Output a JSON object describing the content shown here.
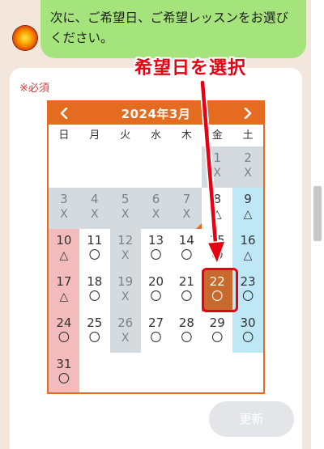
{
  "chat": {
    "message": "次に、ご希望日、ご希望レッスンをお選びください。"
  },
  "form": {
    "required_label": "※必須",
    "update_label": "更新"
  },
  "calendar": {
    "title": "2024年3月",
    "prev_icon": "chevron-left-icon",
    "next_icon": "chevron-right-icon",
    "weekdays": [
      "日",
      "月",
      "火",
      "水",
      "木",
      "金",
      "土"
    ],
    "rows": [
      [
        {
          "day": "",
          "mark": "",
          "kind": "empty"
        },
        {
          "day": "",
          "mark": "",
          "kind": "empty"
        },
        {
          "day": "",
          "mark": "",
          "kind": "empty"
        },
        {
          "day": "",
          "mark": "",
          "kind": "empty"
        },
        {
          "day": "",
          "mark": "",
          "kind": "empty"
        },
        {
          "day": "1",
          "mark": "X",
          "kind": "closed"
        },
        {
          "day": "2",
          "mark": "X",
          "kind": "closed"
        }
      ],
      [
        {
          "day": "3",
          "mark": "X",
          "kind": "closed"
        },
        {
          "day": "4",
          "mark": "X",
          "kind": "closed"
        },
        {
          "day": "5",
          "mark": "X",
          "kind": "closed"
        },
        {
          "day": "6",
          "mark": "X",
          "kind": "closed"
        },
        {
          "day": "7",
          "mark": "X",
          "kind": "closed-corner"
        },
        {
          "day": "8",
          "mark": "△",
          "kind": "open"
        },
        {
          "day": "9",
          "mark": "△",
          "kind": "sat"
        }
      ],
      [
        {
          "day": "10",
          "mark": "△",
          "kind": "sun"
        },
        {
          "day": "11",
          "mark": "〇",
          "kind": "open"
        },
        {
          "day": "12",
          "mark": "X",
          "kind": "closed"
        },
        {
          "day": "13",
          "mark": "〇",
          "kind": "open"
        },
        {
          "day": "14",
          "mark": "〇",
          "kind": "open"
        },
        {
          "day": "15",
          "mark": "〇",
          "kind": "open"
        },
        {
          "day": "16",
          "mark": "△",
          "kind": "sat"
        }
      ],
      [
        {
          "day": "17",
          "mark": "△",
          "kind": "sun"
        },
        {
          "day": "18",
          "mark": "〇",
          "kind": "open"
        },
        {
          "day": "19",
          "mark": "X",
          "kind": "closed"
        },
        {
          "day": "20",
          "mark": "〇",
          "kind": "open"
        },
        {
          "day": "21",
          "mark": "〇",
          "kind": "open"
        },
        {
          "day": "22",
          "mark": "〇",
          "kind": "sel"
        },
        {
          "day": "23",
          "mark": "〇",
          "kind": "sat"
        }
      ],
      [
        {
          "day": "24",
          "mark": "〇",
          "kind": "sun"
        },
        {
          "day": "25",
          "mark": "〇",
          "kind": "open"
        },
        {
          "day": "26",
          "mark": "X",
          "kind": "closed"
        },
        {
          "day": "27",
          "mark": "〇",
          "kind": "open"
        },
        {
          "day": "28",
          "mark": "〇",
          "kind": "open"
        },
        {
          "day": "29",
          "mark": "〇",
          "kind": "open"
        },
        {
          "day": "30",
          "mark": "〇",
          "kind": "sat"
        }
      ],
      [
        {
          "day": "31",
          "mark": "〇",
          "kind": "sun"
        },
        {
          "day": "",
          "mark": "",
          "kind": "empty"
        },
        {
          "day": "",
          "mark": "",
          "kind": "empty"
        },
        {
          "day": "",
          "mark": "",
          "kind": "empty"
        },
        {
          "day": "",
          "mark": "",
          "kind": "empty"
        },
        {
          "day": "",
          "mark": "",
          "kind": "empty"
        },
        {
          "day": "",
          "mark": "",
          "kind": "empty"
        }
      ]
    ]
  },
  "annotation": {
    "label": "希望日を選択",
    "color": "#e60012"
  },
  "colors": {
    "accent": "#e46b1f",
    "chat_bubble": "#a5e37d",
    "closed": "#d5dadf",
    "sunday": "#f3bbbb",
    "saturday": "#bfe8f7",
    "selected": "#c86a2d"
  }
}
